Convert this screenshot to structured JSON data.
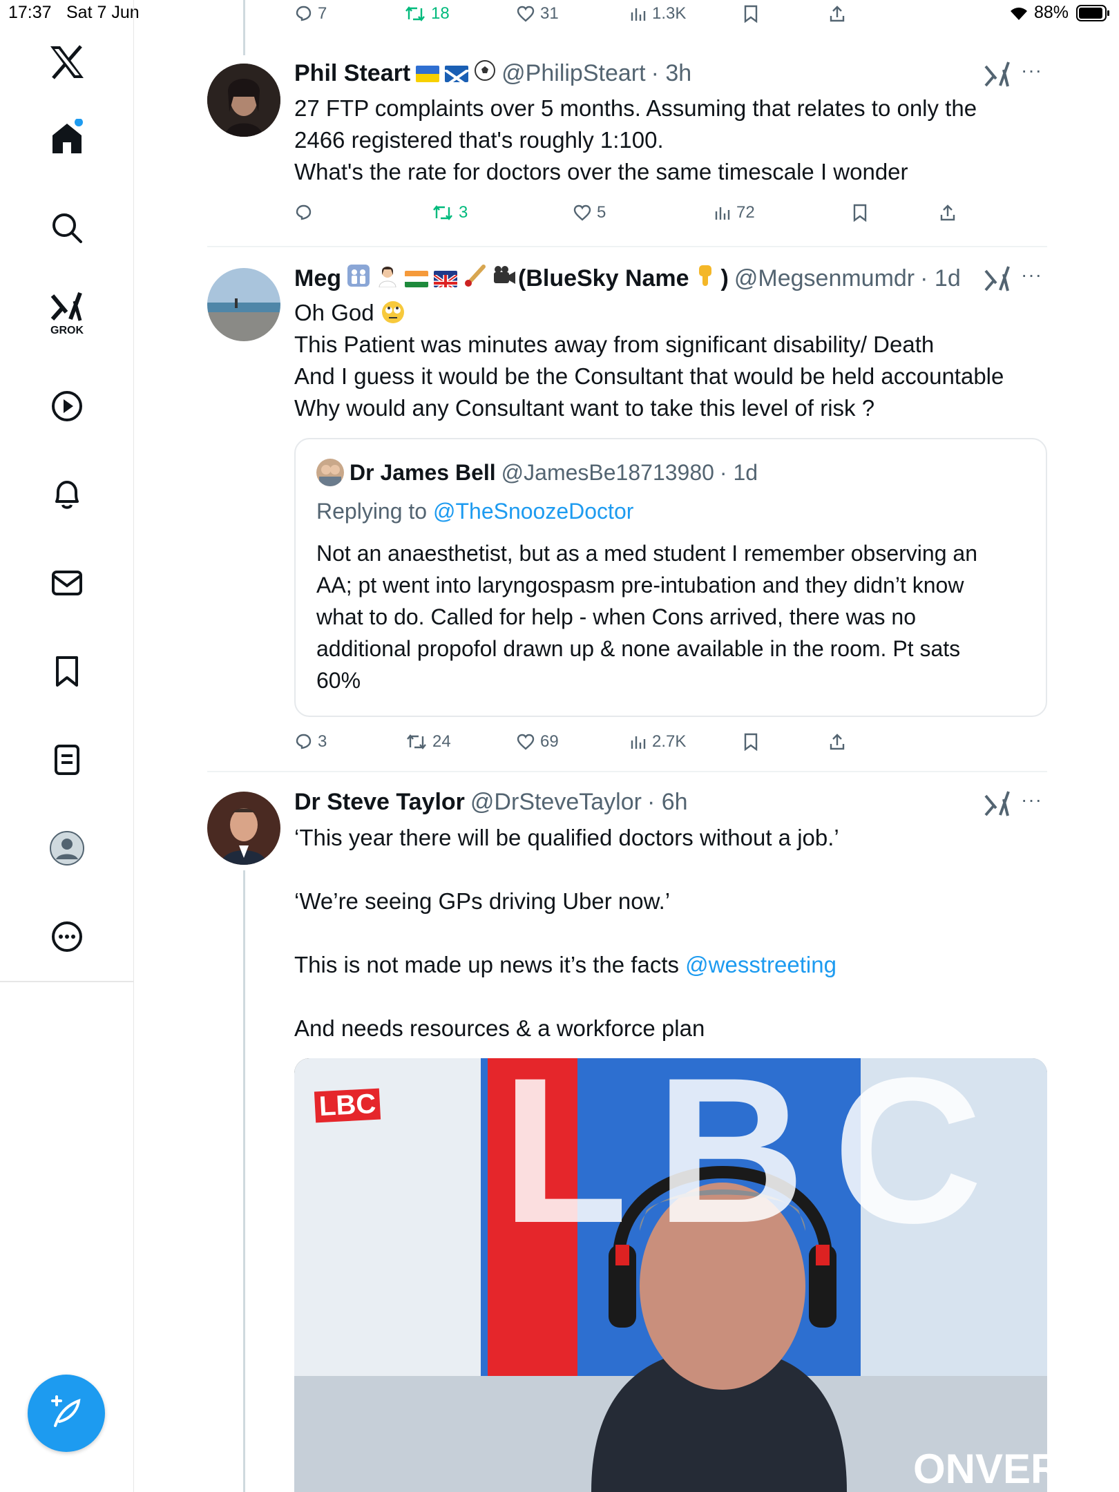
{
  "status_bar": {
    "time": "17:37",
    "date": "Sat 7 Jun",
    "battery": "88%"
  },
  "sidebar": {
    "items": [
      {
        "name": "x-logo"
      },
      {
        "name": "home",
        "badge": true
      },
      {
        "name": "search"
      },
      {
        "name": "grok",
        "label": "GROK"
      },
      {
        "name": "video"
      },
      {
        "name": "notifications"
      },
      {
        "name": "messages"
      },
      {
        "name": "bookmarks"
      },
      {
        "name": "lists"
      },
      {
        "name": "profile"
      },
      {
        "name": "more"
      }
    ]
  },
  "top_actions": {
    "replies": "7",
    "reposts": "18",
    "likes": "31",
    "views": "1.3K"
  },
  "tweets": [
    {
      "name": "Phil Steart",
      "handle": "@PhilipSteart",
      "time": "· 3h",
      "lines": [
        "27 FTP complaints over 5 months. Assuming that relates to only the",
        "2466 registered that's roughly 1:100.",
        "What's the rate for doctors over the same timescale I wonder"
      ],
      "actions": {
        "replies": "",
        "reposts": "3",
        "likes": "5",
        "views": "72"
      }
    },
    {
      "name": "Meg",
      "name_suffix": "(BlueSky Name",
      "name_close": ")",
      "handle": "@Megsenmumdr",
      "time": "· 1d",
      "lines": [
        "Oh God",
        "This Patient was minutes away from significant disability/ Death",
        "And I guess it would be the Consultant that would be held accountable",
        "Why would any Consultant want to take this level of risk ?"
      ],
      "quote": {
        "name": "Dr James Bell",
        "handle": "@JamesBe18713980",
        "time": "· 1d",
        "replying_prefix": "Replying to",
        "replying_to": "@TheSnoozeDoctor",
        "lines": [
          "Not an anaesthetist, but as a med student I remember observing an",
          "AA; pt went into laryngospasm pre-intubation and they didn’t know",
          "what to do. Called for help - when Cons arrived, there was no",
          "additional propofol drawn up & none available in the room. Pt sats",
          "60%"
        ]
      },
      "actions": {
        "replies": "3",
        "reposts": "24",
        "likes": "69",
        "views": "2.7K"
      }
    },
    {
      "name": "Dr Steve Taylor",
      "handle": "@DrSteveTaylor",
      "time": "· 6h",
      "line1": "‘This year there will be qualified doctors without a job.’",
      "line2": "‘We’re seeing GPs driving Uber now.’",
      "line3_text": "This is not made up news it’s the facts",
      "line3_link": "@wesstreeting",
      "line4": "And needs resources & a workforce plan",
      "media": {
        "logo": "LBC",
        "bg_letters": "LBC",
        "caption_fragment": "ONVERS"
      }
    }
  ],
  "colors": {
    "accent": "#1d9bf0",
    "repost": "#00ba7c",
    "muted": "#536471"
  }
}
